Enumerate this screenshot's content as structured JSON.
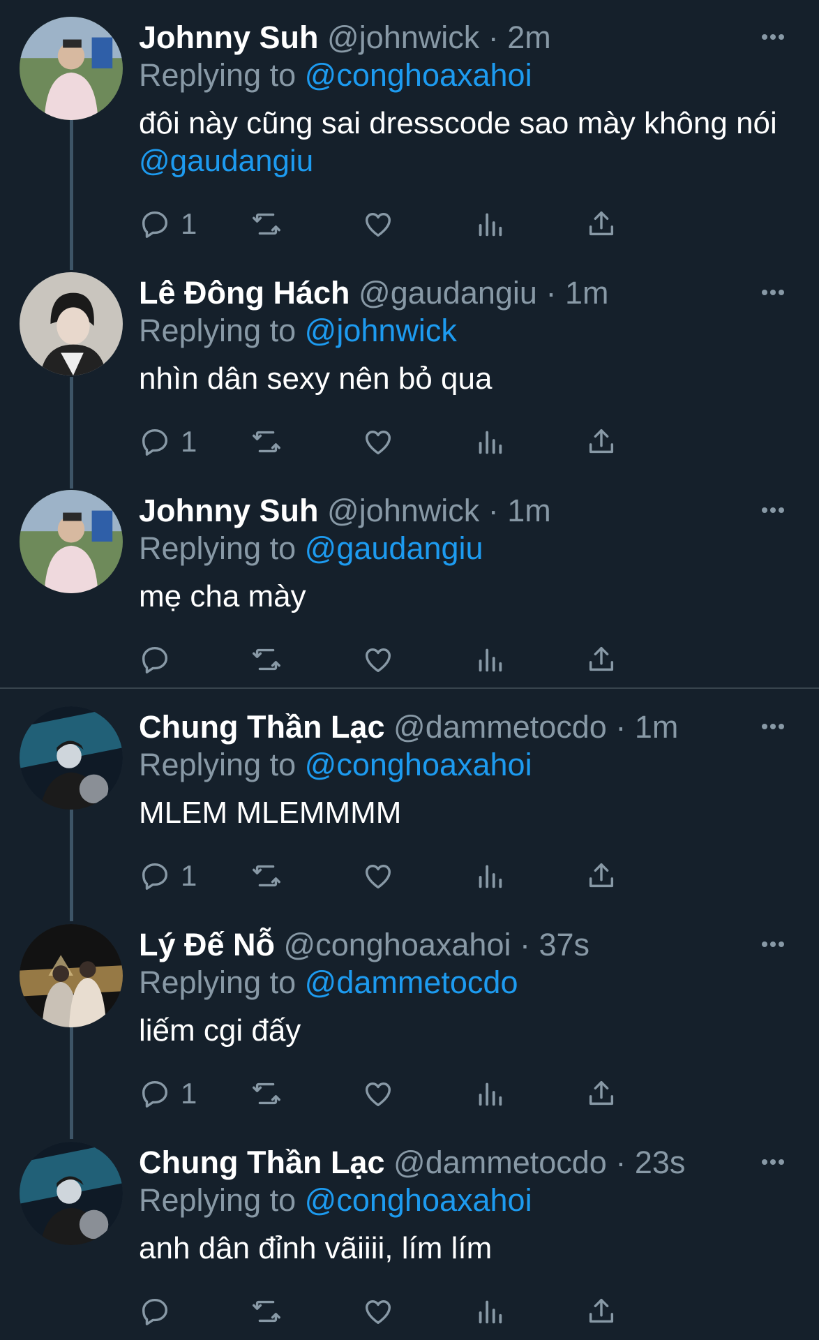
{
  "colors": {
    "background": "#15202b",
    "text": "#ffffff",
    "secondary": "#8899a6",
    "mention": "#1d9bf0",
    "thread_line": "#3d5466",
    "separator": "#38444d"
  },
  "icons": {
    "reply": "reply-icon",
    "retweet": "retweet-icon",
    "like": "heart-icon",
    "views": "views-icon",
    "share": "share-icon",
    "more": "more-icon"
  },
  "tweets": [
    {
      "name": "Johnny Suh",
      "handle": "@johnwick",
      "time": "2m",
      "replying_label": "Replying to",
      "replying_to": "@conghoaxahoi",
      "text": "đôi này cũng sai dresscode sao mày không nói ",
      "text_mention": "@gaudangiu",
      "reply_count": "1"
    },
    {
      "name": "Lê Đông Hách",
      "handle": "@gaudangiu",
      "time": "1m",
      "replying_label": "Replying to",
      "replying_to": "@johnwick",
      "text": "nhìn dân sexy nên bỏ qua",
      "text_mention": "",
      "reply_count": "1"
    },
    {
      "name": "Johnny Suh",
      "handle": "@johnwick",
      "time": "1m",
      "replying_label": "Replying to",
      "replying_to": "@gaudangiu",
      "text": "mẹ cha mày",
      "text_mention": "",
      "reply_count": ""
    },
    {
      "name": "Chung Thần Lạc",
      "handle": "@dammetocdo",
      "time": "1m",
      "replying_label": "Replying to",
      "replying_to": "@conghoaxahoi",
      "text": "MLEM MLEMMMM",
      "text_mention": "",
      "reply_count": "1"
    },
    {
      "name": "Lý Đế Nỗ",
      "handle": "@conghoaxahoi",
      "time": "37s",
      "replying_label": "Replying to",
      "replying_to": "@dammetocdo",
      "text": "liếm cgi đấy",
      "text_mention": "",
      "reply_count": "1"
    },
    {
      "name": "Chung Thần Lạc",
      "handle": "@dammetocdo",
      "time": "23s",
      "replying_label": "Replying to",
      "replying_to": "@conghoaxahoi",
      "text": "anh dân đỉnh vãiiii, lím lím",
      "text_mention": "",
      "reply_count": ""
    }
  ]
}
